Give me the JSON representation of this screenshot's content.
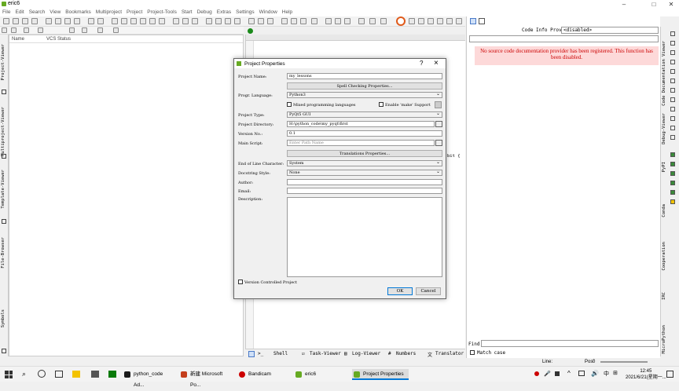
{
  "window": {
    "title": "eric6"
  },
  "menu": [
    "File",
    "Edit",
    "Search",
    "View",
    "Bookmarks",
    "Multiproject",
    "Project",
    "Project-Tools",
    "Start",
    "Debug",
    "Extras",
    "Settings",
    "Window",
    "Help"
  ],
  "left_sidebar": [
    "Project-Viewer",
    "Multiproject-Viewer",
    "Template-Viewer",
    "File-Browser",
    "Symbols"
  ],
  "project_panel": {
    "col_name": "Name",
    "col_vcs": "VCS Status"
  },
  "editor": {
    "code_fragment": "bit {"
  },
  "bottom_tabs": [
    "Shell",
    "Task-Viewer",
    "Log-Viewer",
    "Numbers",
    "Translator"
  ],
  "code_info": {
    "label": "Code Info Provider:",
    "provider": "<disabled>",
    "warning": "No source code documentation provider has been registered. This function has been disabled.",
    "find_label": "Find:",
    "match_case": "Match case"
  },
  "right_sidebar": [
    "Code Documentation Viewer",
    "Debug-Viewer",
    "PyPI",
    "Conda",
    "Cooperation",
    "IRC",
    "MicroPython"
  ],
  "status": {
    "line_label": "Line:",
    "pos_label": "Pos:",
    "pos_value": "0"
  },
  "dialog": {
    "title": "Project Properties",
    "help": "?",
    "project_name_label": "Project Name:",
    "project_name": "my_lessons",
    "spell_button": "Spell Checking Properties...",
    "prog_language_label": "Progr. Language:",
    "prog_language": "Python3",
    "mixed_label": "Mixed programming languages",
    "make_label": "Enable 'make' Support",
    "project_type_label": "Project Type:",
    "project_type": "PyQt5 GUI",
    "project_dir_label": "Project Directory:",
    "project_dir": "H:\\python_code\\my_pyqt\\first",
    "version_label": "Version No.:",
    "version": "0.1",
    "main_script_label": "Main Script:",
    "main_script_placeholder": "Enter Path Name",
    "translations_button": "Translations Properties...",
    "eol_label": "End of Line Character:",
    "eol": "System",
    "docstring_label": "Docstring Style:",
    "docstring": "None",
    "author_label": "Author:",
    "email_label": "Email:",
    "description_label": "Description:",
    "vcs_label": "Version Controlled Project",
    "ok": "OK",
    "cancel": "Cancel"
  },
  "taskbar": {
    "items": [
      "python_code Ad...",
      "新建 Microsoft Po...",
      "Bandicam",
      "eric6",
      "Project Properties"
    ],
    "time": "12:45",
    "date": "2021/6/21(星期一..."
  }
}
